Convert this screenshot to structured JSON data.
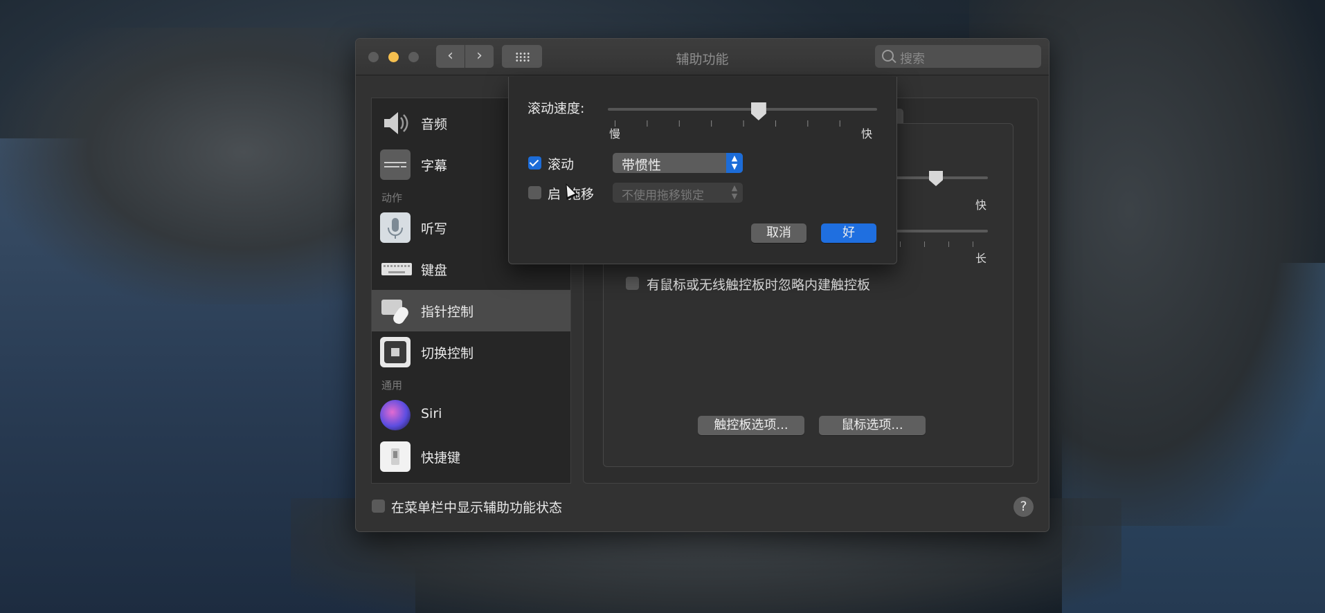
{
  "window": {
    "title": "辅助功能"
  },
  "search": {
    "placeholder": "搜索"
  },
  "nav": {
    "back_icon": "chevron-left-icon",
    "forward_icon": "chevron-right-icon",
    "grid_icon": "grid-icon"
  },
  "sidebar": {
    "items": [
      {
        "label": "音频",
        "icon": "speaker-icon"
      },
      {
        "label": "字幕",
        "icon": "captions-icon"
      },
      {
        "label": "听写",
        "icon": "microphone-icon"
      },
      {
        "label": "键盘",
        "icon": "keyboard-icon"
      },
      {
        "label": "指针控制",
        "icon": "pointer-control-icon",
        "selected": true
      },
      {
        "label": "切换控制",
        "icon": "switch-control-icon"
      },
      {
        "label": "Siri",
        "icon": "siri-icon"
      },
      {
        "label": "快捷键",
        "icon": "shortcut-icon"
      }
    ],
    "sections": {
      "motor": "动作",
      "general": "通用"
    }
  },
  "main": {
    "bg_fast_label": "快",
    "bg_long_label": "长",
    "ignore_trackpad_label": "有鼠标或无线触控板时忽略内建触控板",
    "trackpad_options_button": "触控板选项...",
    "mouse_options_button": "鼠标选项..."
  },
  "footer": {
    "show_status_label": "在菜单栏中显示辅助功能状态",
    "help_label": "?"
  },
  "sheet": {
    "speed_label": "滚动速度:",
    "speed_min": "慢",
    "speed_max": "快",
    "speed_value": 0.56,
    "scroll_label": "滚动",
    "scroll_checked": true,
    "scroll_option": "带惯性",
    "drag_label_part1": "启",
    "drag_label_part2": "拖移",
    "drag_checked": false,
    "drag_option": "不使用拖移锁定",
    "cancel_button": "取消",
    "ok_button": "好"
  },
  "colors": {
    "accent": "#1f6fe0",
    "window_bg": "#323232"
  }
}
